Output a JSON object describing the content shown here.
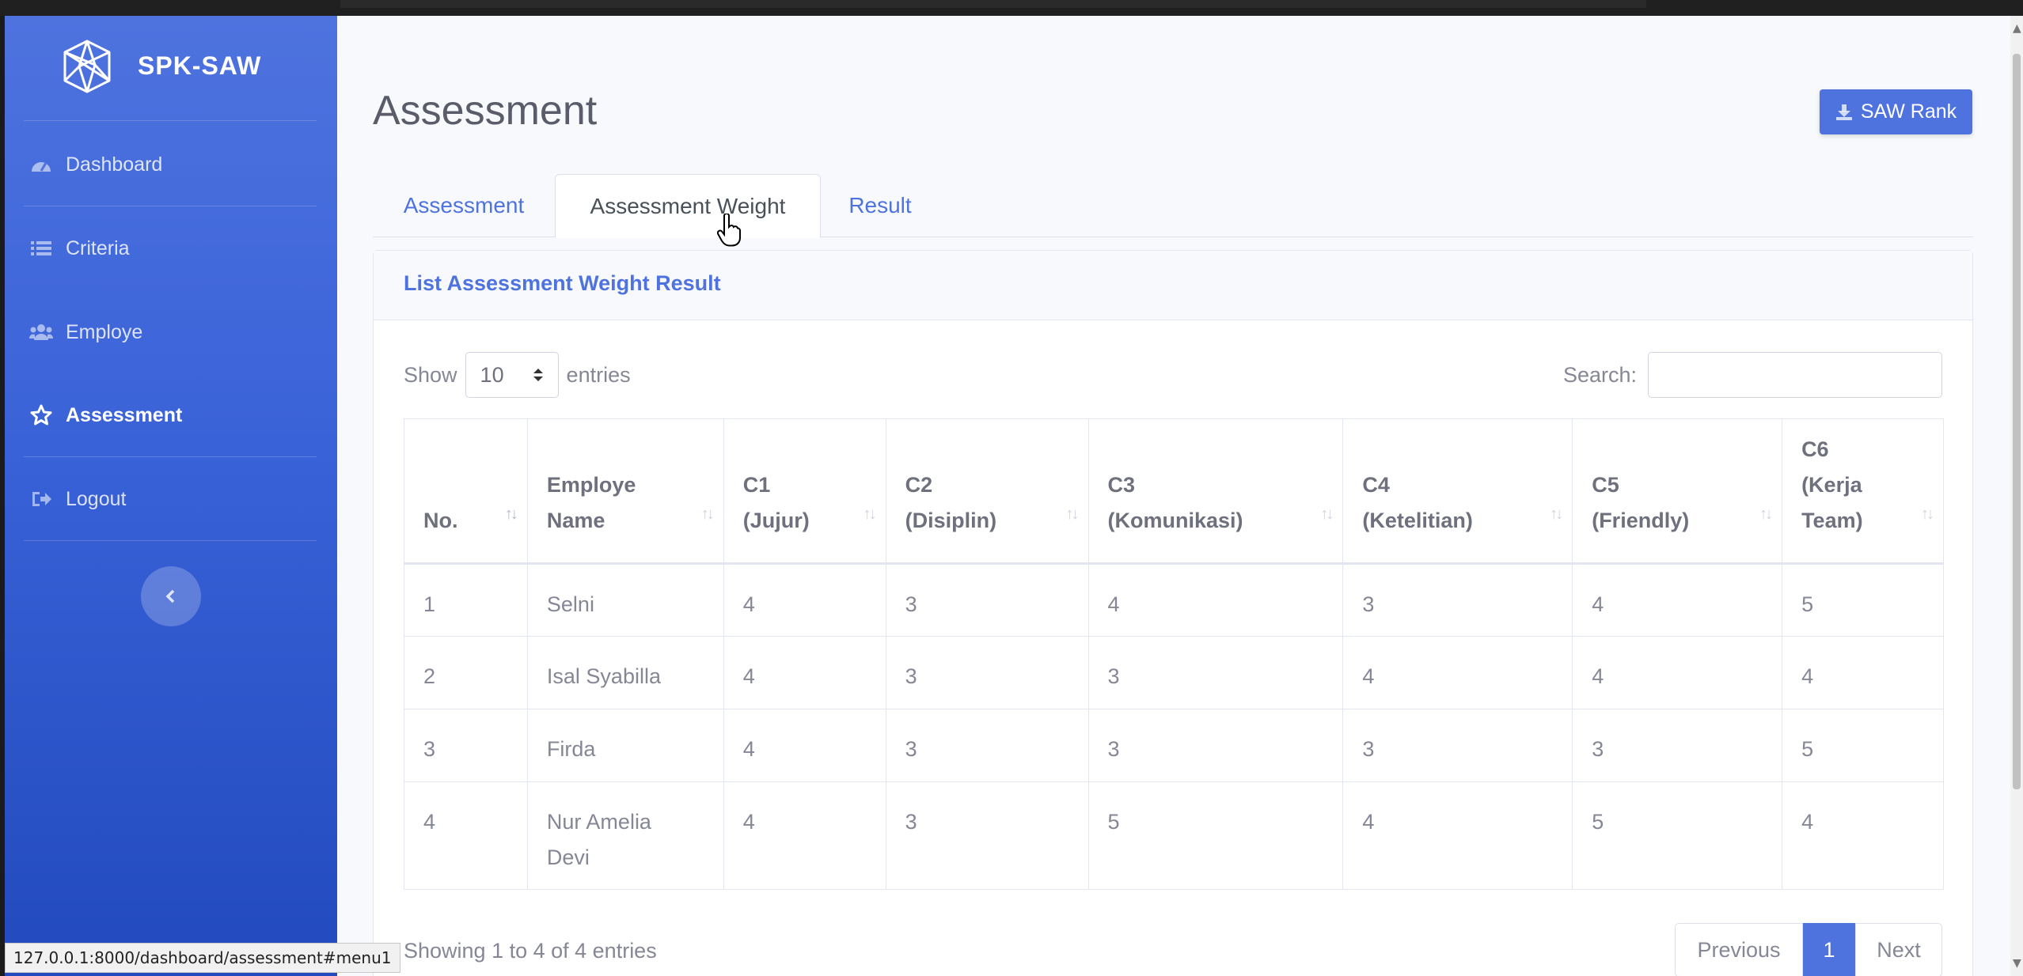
{
  "status_url": "127.0.0.1:8000/dashboard/assessment#menu1",
  "sidebar": {
    "brand": "SPK-SAW",
    "items": [
      {
        "label": "Dashboard",
        "icon": "tachometer-icon"
      },
      {
        "label": "Criteria",
        "icon": "list-icon"
      },
      {
        "label": "Employe",
        "icon": "users-icon"
      },
      {
        "label": "Assessment",
        "icon": "star-icon",
        "active": true
      },
      {
        "label": "Logout",
        "icon": "sign-out-icon"
      }
    ],
    "toggle": "‹"
  },
  "header": {
    "title": "Assessment",
    "saw_button": "SAW Rank"
  },
  "tabs": [
    {
      "label": "Assessment"
    },
    {
      "label": "Assessment Weight",
      "active": true
    },
    {
      "label": "Result"
    }
  ],
  "card": {
    "title": "List Assessment Weight Result",
    "show_label": "Show",
    "entries_value": "10",
    "entries_label": "entries",
    "search_label": "Search:",
    "columns": [
      {
        "line1": "No.",
        "line2": ""
      },
      {
        "line1": "Employe",
        "line2": "Name"
      },
      {
        "line1": "C1",
        "line2": "(Jujur)"
      },
      {
        "line1": "C2",
        "line2": "(Disiplin)"
      },
      {
        "line1": "C3",
        "line2": "(Komunikasi)"
      },
      {
        "line1": "C4",
        "line2": "(Ketelitian)"
      },
      {
        "line1": "C5",
        "line2": "(Friendly)"
      },
      {
        "line1": "C6",
        "line2": "(Kerja",
        "line3": "Team)"
      }
    ],
    "rows": [
      {
        "no": "1",
        "name": "Selni",
        "c1": "4",
        "c2": "3",
        "c3": "4",
        "c4": "3",
        "c5": "4",
        "c6": "5"
      },
      {
        "no": "2",
        "name": "Isal Syabilla",
        "c1": "4",
        "c2": "3",
        "c3": "3",
        "c4": "4",
        "c5": "4",
        "c6": "4"
      },
      {
        "no": "3",
        "name": "Firda",
        "c1": "4",
        "c2": "3",
        "c3": "3",
        "c4": "3",
        "c5": "3",
        "c6": "5"
      },
      {
        "no": "4",
        "name": "Nur Amelia",
        "name2": "Devi",
        "c1": "4",
        "c2": "3",
        "c3": "5",
        "c4": "4",
        "c5": "5",
        "c6": "4"
      }
    ],
    "info": "Showing 1 to 4 of 4 entries",
    "pager": {
      "prev": "Previous",
      "current": "1",
      "next": "Next"
    }
  }
}
